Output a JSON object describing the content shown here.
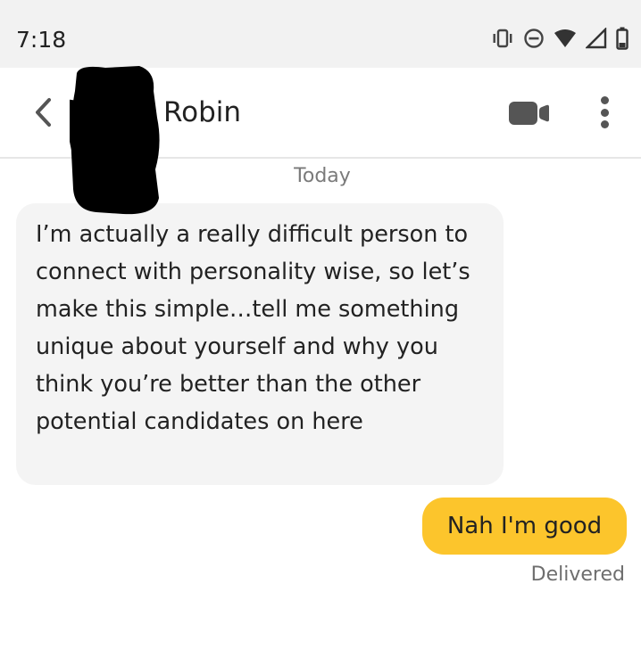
{
  "status_bar": {
    "time": "7:18",
    "icons": [
      "vibrate-icon",
      "do-not-disturb-icon",
      "wifi-icon",
      "cell-signal-icon",
      "battery-icon"
    ]
  },
  "header": {
    "contact_name": "Robin",
    "back_icon": "chevron-left-icon",
    "video_icon": "video-camera-icon",
    "more_icon": "more-vertical-icon"
  },
  "conversation": {
    "date_label": "Today",
    "messages": [
      {
        "direction": "incoming",
        "text": "I’m actually a really difficult person to connect with personality wise, so let’s make this simple…tell me something unique about yourself and why you think you’re better than the other potential candidates on here"
      },
      {
        "direction": "outgoing",
        "text": "Nah I'm good",
        "status": "Delivered"
      }
    ]
  },
  "colors": {
    "outgoing_bubble": "#fcc52c",
    "incoming_bubble": "#f4f4f4",
    "status_bar_bg": "#f2f2f2",
    "icon_gray": "#555555"
  }
}
